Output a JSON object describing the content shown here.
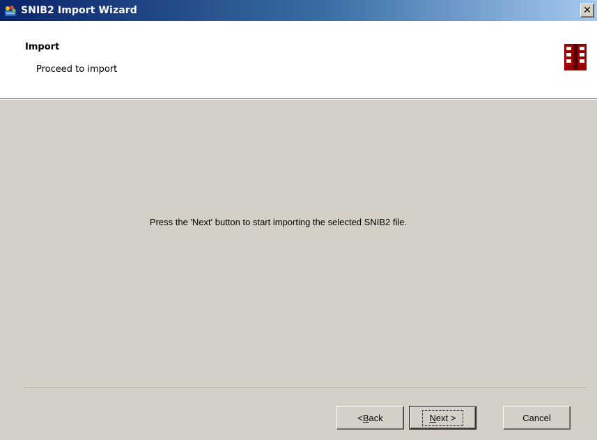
{
  "window": {
    "title": "SNIB2 Import Wizard",
    "close_label": "✕",
    "icon": "wizard-app-icon",
    "close_icon": "close-icon"
  },
  "header": {
    "title": "Import",
    "subtitle": "Proceed to import",
    "logo_icon": "building-logo-icon",
    "logo_color": "#9b0000"
  },
  "content": {
    "message": "Press the 'Next' button to start importing the selected SNIB2 file."
  },
  "buttons": {
    "back": {
      "prefix": "< ",
      "mnemonic": "B",
      "rest": "ack"
    },
    "next": {
      "mnemonic": "N",
      "rest": "ext >"
    },
    "cancel": {
      "label": "Cancel"
    }
  },
  "colors": {
    "titlebar_start": "#0a246a",
    "titlebar_end": "#a6caf0",
    "dialog_bg": "#d4d0c8"
  }
}
